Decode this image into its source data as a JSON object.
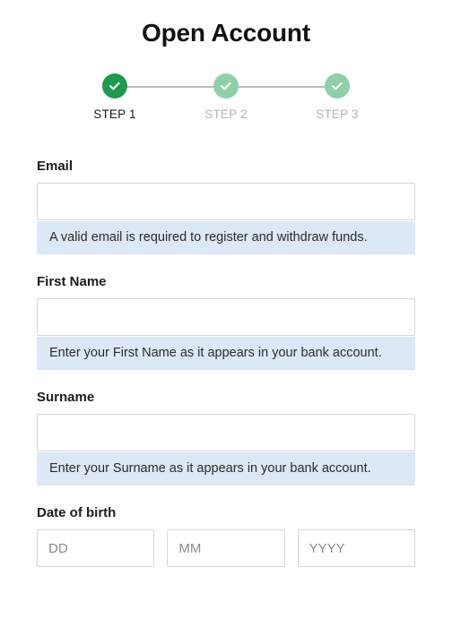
{
  "header": {
    "title": "Open Account"
  },
  "stepper": {
    "check_icon": "check-icon",
    "steps": [
      {
        "label": "STEP 1",
        "state": "active"
      },
      {
        "label": "STEP 2",
        "state": "inactive"
      },
      {
        "label": "STEP 3",
        "state": "inactive"
      }
    ],
    "colors": {
      "active_circle": "#1d9a4f",
      "inactive_circle": "#8ed0a7",
      "connector_line": "#bcbcbc",
      "active_label": "#1a1a1a",
      "inactive_label": "#b4b4b4"
    }
  },
  "form": {
    "fields": [
      {
        "name": "email",
        "label": "Email",
        "value": "",
        "placeholder": "",
        "hint": "A valid email is required to register and withdraw funds."
      },
      {
        "name": "first-name",
        "label": "First Name",
        "value": "",
        "placeholder": "",
        "hint": "Enter your First Name as it appears in your bank account."
      },
      {
        "name": "surname",
        "label": "Surname",
        "value": "",
        "placeholder": "",
        "hint": "Enter your Surname as it appears in your bank account."
      }
    ],
    "date_of_birth": {
      "label": "Date of birth",
      "day": {
        "placeholder": "DD",
        "value": ""
      },
      "month": {
        "placeholder": "MM",
        "value": ""
      },
      "year": {
        "placeholder": "YYYY",
        "value": ""
      }
    },
    "colors": {
      "input_border": "#d6d6d6",
      "hint_background": "#dce8f6",
      "hint_text": "#2b2b2b"
    }
  }
}
